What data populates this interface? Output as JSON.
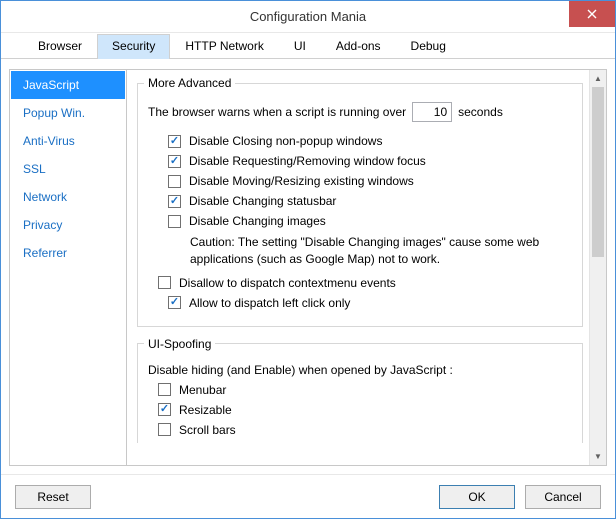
{
  "window": {
    "title": "Configuration Mania"
  },
  "tabs": {
    "browser": "Browser",
    "security": "Security",
    "http": "HTTP Network",
    "ui": "UI",
    "addons": "Add-ons",
    "debug": "Debug"
  },
  "sidebar": {
    "items": [
      {
        "label": "JavaScript"
      },
      {
        "label": "Popup Win."
      },
      {
        "label": "Anti-Virus"
      },
      {
        "label": "SSL"
      },
      {
        "label": "Network"
      },
      {
        "label": "Privacy"
      },
      {
        "label": "Referrer"
      }
    ]
  },
  "more_advanced": {
    "legend": "More Advanced",
    "warn_prefix": "The browser warns when a script is running over",
    "warn_value": "10",
    "warn_suffix": "seconds",
    "chk_close_nonpopup": "Disable Closing non-popup windows",
    "chk_req_focus": "Disable Requesting/Removing window focus",
    "chk_move_resize": "Disable Moving/Resizing existing windows",
    "chk_statusbar": "Disable Changing statusbar",
    "chk_images": "Disable Changing images",
    "caution": "Caution: The setting \"Disable Changing images\" cause some web applications (such as Google Map) not to work.",
    "chk_contextmenu": "Disallow to dispatch contextmenu events",
    "chk_leftclick": "Allow to dispatch left click only"
  },
  "ui_spoofing": {
    "legend": "UI-Spoofing",
    "desc": "Disable hiding (and Enable) when opened by JavaScript :",
    "chk_menubar": "Menubar",
    "chk_resizable": "Resizable",
    "chk_scrollbars": "Scroll bars"
  },
  "footer": {
    "reset": "Reset",
    "ok": "OK",
    "cancel": "Cancel"
  }
}
